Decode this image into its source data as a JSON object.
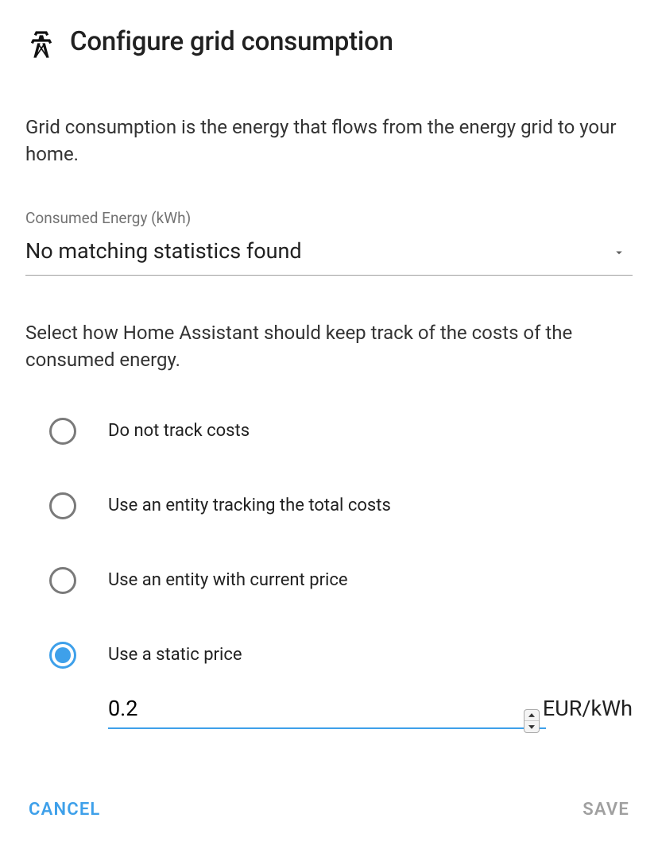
{
  "header": {
    "title": "Configure grid consumption"
  },
  "intro": "Grid consumption is the energy that flows from the energy grid to your home.",
  "consumed_energy": {
    "label": "Consumed Energy (kWh)",
    "selected": "No matching statistics found"
  },
  "costs_label": "Select how Home Assistant should keep track of the costs of the consumed energy.",
  "options": {
    "no_track": "Do not track costs",
    "entity_total": "Use an entity tracking the total costs",
    "entity_current": "Use an entity with current price",
    "static_price": "Use a static price"
  },
  "static_price": {
    "value": "0.2",
    "unit": "EUR/kWh"
  },
  "actions": {
    "cancel": "CANCEL",
    "save": "SAVE"
  }
}
